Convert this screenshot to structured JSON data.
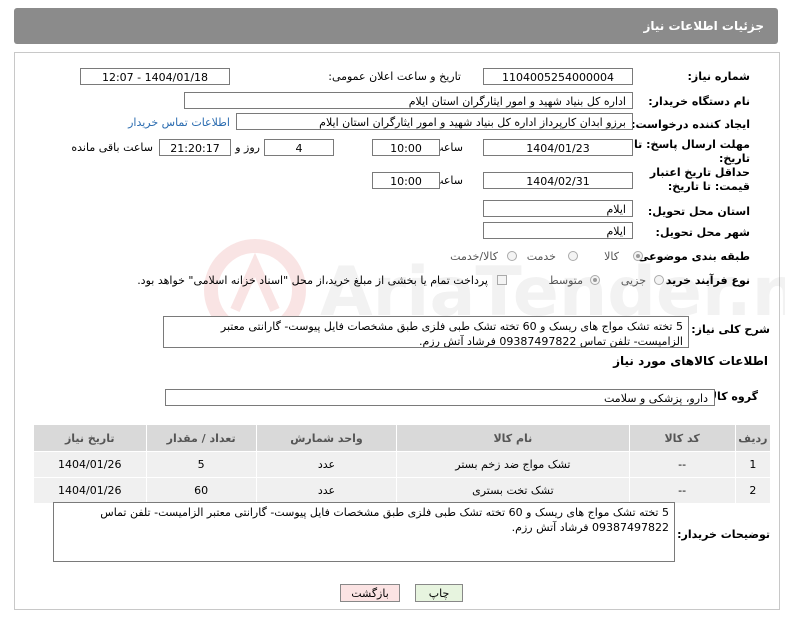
{
  "header": {
    "title": "جزئیات اطلاعات نیاز"
  },
  "form": {
    "need_number_label": "شماره نیاز:",
    "need_number": "1104005254000004",
    "announce_label": "تاریخ و ساعت اعلان عمومی:",
    "announce_value": "1404/01/18 - 12:07",
    "buyer_label": "نام دستگاه خریدار:",
    "buyer_value": "اداره کل بنیاد شهید و امور ایثارگران استان ایلام",
    "creator_label": "ایجاد کننده درخواست:",
    "creator_value": "برزو ابدان کارپرداز اداره کل بنیاد شهید و امور ایثارگران استان ایلام",
    "contact_link": "اطلاعات تماس خریدار",
    "deadline_label": "مهلت ارسال پاسخ: تا تاریخ:",
    "deadline_date": "1404/01/23",
    "time_label": "ساعت",
    "deadline_time": "10:00",
    "days_value": "4",
    "days_label": "روز و",
    "remaining_value": "21:20:17",
    "remaining_label": "ساعت باقی مانده",
    "price_valid_label": "حداقل تاریخ اعتبار قیمت: تا تاریخ:",
    "price_valid_date": "1404/02/31",
    "price_valid_time": "10:00",
    "province_label": "استان محل تحویل:",
    "province_value": "ایلام",
    "city_label": "شهر محل تحویل:",
    "city_value": "ایلام",
    "category_label": "طبقه بندی موضوعی:",
    "category_options": [
      "کالا",
      "خدمت",
      "کالا/خدمت"
    ],
    "category_selected": "کالا",
    "process_label": "نوع فرآیند خرید :",
    "process_options": [
      "جزیی",
      "متوسط"
    ],
    "process_selected": "متوسط",
    "payment_note": "پرداخت تمام یا بخشی از مبلغ خرید،از محل \"اسناد خزانه اسلامی\" خواهد بود."
  },
  "description": {
    "label": "شرح کلی نیاز:",
    "text": "5 تخته تشک مواج های ریسک و 60 تخته تشک طبی فلزی  طبق مشخصات فایل پیوست- گارانتی معتبر الزامیست- تلفن تماس 09387497822 فرشاد آتش رزم."
  },
  "goods": {
    "section_title": "اطلاعات کالاهای مورد نیاز",
    "group_label": "گروه کالا:",
    "group_value": "دارو، پزشکی و سلامت",
    "columns": [
      "ردیف",
      "کد کالا",
      "نام کالا",
      "واحد شمارش",
      "تعداد / مقدار",
      "تاریخ نیاز"
    ],
    "rows": [
      [
        "1",
        "--",
        "تشک مواج ضد زخم بستر",
        "عدد",
        "5",
        "1404/01/26"
      ],
      [
        "2",
        "--",
        "تشک تخت بستری",
        "عدد",
        "60",
        "1404/01/26"
      ]
    ]
  },
  "buyer_notes": {
    "label": "توضیحات خریدار:",
    "text": "5 تخته تشک مواج های ریسک و 60 تخته تشک طبی فلزی  طبق مشخصات فایل پیوست- گارانتی معتبر الزامیست- تلفن تماس 09387497822 فرشاد آتش رزم."
  },
  "buttons": {
    "print": "چاپ",
    "back": "بازگشت"
  },
  "colors": {
    "header_bg": "#8b8b8b",
    "link": "#2b6cb0",
    "print_bg": "#e7f4df",
    "back_bg": "#fbe3e3"
  },
  "watermark": {
    "text": "AriaTender.neT"
  }
}
